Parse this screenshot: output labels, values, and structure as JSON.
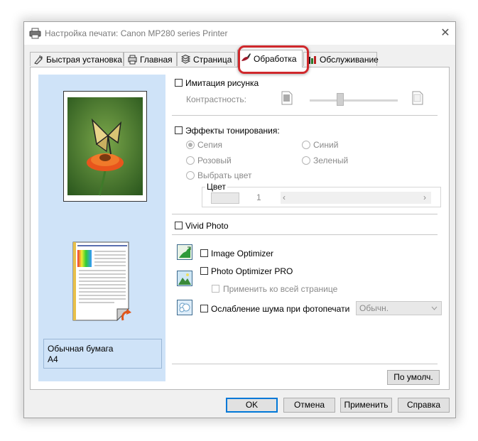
{
  "window": {
    "title": "Настройка печати: Canon MP280 series Printer"
  },
  "tabs": [
    {
      "label": "Быстрая установка",
      "icon": "quick-setup-icon"
    },
    {
      "label": "Главная",
      "icon": "main-icon"
    },
    {
      "label": "Страница",
      "icon": "page-icon"
    },
    {
      "label": "Обработка",
      "icon": "effects-icon",
      "active": true
    },
    {
      "label": "Обслуживание",
      "icon": "maintenance-icon"
    }
  ],
  "preview": {
    "paper_type": "Обычная бумага",
    "paper_size": "A4"
  },
  "simulate": {
    "label": "Имитация рисунка",
    "contrast_label": "Контрастность:"
  },
  "toning": {
    "label": "Эффекты тонирования:",
    "options": {
      "sepia": "Сепия",
      "blue": "Синий",
      "pink": "Розовый",
      "green": "Зеленый",
      "select_color": "Выбрать цвет"
    },
    "selected": "Сепия",
    "color_group_label": "Цвет",
    "color_value": "1"
  },
  "vivid_photo": {
    "label": "Vivid Photo"
  },
  "image_optimizer": {
    "label": "Image Optimizer"
  },
  "photo_optimizer": {
    "label": "Photo Optimizer PRO",
    "apply_all_label": "Применить ко всей странице"
  },
  "noise": {
    "label": "Ослабление шума при фотопечати",
    "selected": "Обычн."
  },
  "buttons": {
    "defaults": "По умолч.",
    "ok": "OK",
    "cancel": "Отмена",
    "apply": "Применить",
    "help": "Справка"
  },
  "colors": {
    "highlight": "#d0282c",
    "preview_bg": "#cfe3f8",
    "accent": "#0078d7"
  }
}
